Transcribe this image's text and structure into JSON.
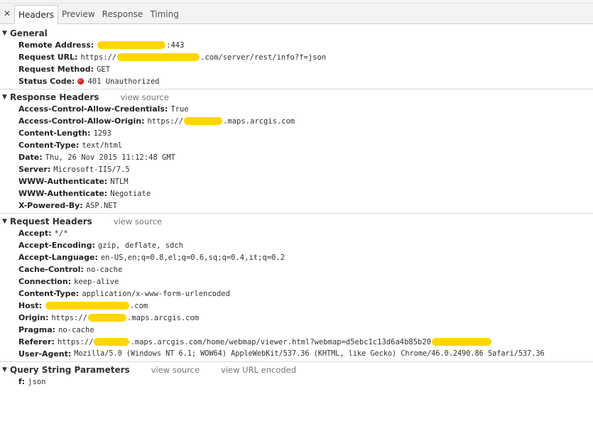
{
  "tabs": {
    "close_glyph": "✕",
    "items": [
      "Headers",
      "Preview",
      "Response",
      "Timing"
    ],
    "active": "Headers"
  },
  "general": {
    "title": "General",
    "remote_address": {
      "key": "Remote Address:",
      "value_suffix": ":443"
    },
    "request_url": {
      "key": "Request URL:",
      "value_prefix": "https://",
      "value_suffix": ".com/server/rest/info?f=json"
    },
    "request_method": {
      "key": "Request Method:",
      "value": "GET"
    },
    "status_code": {
      "key": "Status Code:",
      "value": "401 Unauthorized",
      "status_color": "#d10000"
    }
  },
  "response_headers": {
    "title": "Response Headers",
    "view_source": "view source",
    "acao_credentials": {
      "key": "Access-Control-Allow-Credentials:",
      "value": "True"
    },
    "acao_origin": {
      "key": "Access-Control-Allow-Origin:",
      "value_prefix": "https://",
      "value_suffix": ".maps.arcgis.com"
    },
    "content_length": {
      "key": "Content-Length:",
      "value": "1293"
    },
    "content_type": {
      "key": "Content-Type:",
      "value": "text/html"
    },
    "date": {
      "key": "Date:",
      "value": "Thu, 26 Nov 2015 11:12:48 GMT"
    },
    "server": {
      "key": "Server:",
      "value": "Microsoft-IIS/7.5"
    },
    "www_auth_1": {
      "key": "WWW-Authenticate:",
      "value": "NTLM"
    },
    "www_auth_2": {
      "key": "WWW-Authenticate:",
      "value": "Negotiate"
    },
    "x_powered_by": {
      "key": "X-Powered-By:",
      "value": "ASP.NET"
    }
  },
  "request_headers": {
    "title": "Request Headers",
    "view_source": "view source",
    "accept": {
      "key": "Accept:",
      "value": "*/*"
    },
    "accept_encoding": {
      "key": "Accept-Encoding:",
      "value": "gzip, deflate, sdch"
    },
    "accept_language": {
      "key": "Accept-Language:",
      "value": "en-US,en;q=0.8,el;q=0.6,sq;q=0.4,it;q=0.2"
    },
    "cache_control": {
      "key": "Cache-Control:",
      "value": "no-cache"
    },
    "connection": {
      "key": "Connection:",
      "value": "keep-alive"
    },
    "content_type": {
      "key": "Content-Type:",
      "value": "application/x-www-form-urlencoded"
    },
    "host": {
      "key": "Host:",
      "value_suffix": ".com"
    },
    "origin": {
      "key": "Origin:",
      "value_prefix": "https://",
      "value_suffix": ".maps.arcgis.com"
    },
    "pragma": {
      "key": "Pragma:",
      "value": "no-cache"
    },
    "referer": {
      "key": "Referer:",
      "value_prefix": "https://",
      "value_middle": ".maps.arcgis.com/home/webmap/viewer.html?webmap=d5ebc1c13d6a4b85b20"
    },
    "user_agent": {
      "key": "User-Agent:",
      "value": "Mozilla/5.0 (Windows NT 6.1; WOW64) AppleWebKit/537.36 (KHTML, like Gecko) Chrome/46.0.2490.86 Safari/537.36"
    }
  },
  "query_params": {
    "title": "Query String Parameters",
    "view_source": "view source",
    "view_url_encoded": "view URL encoded",
    "f": {
      "key": "f:",
      "value": "json"
    }
  },
  "colors": {
    "redaction": "#ffd600",
    "link": "#757575"
  }
}
